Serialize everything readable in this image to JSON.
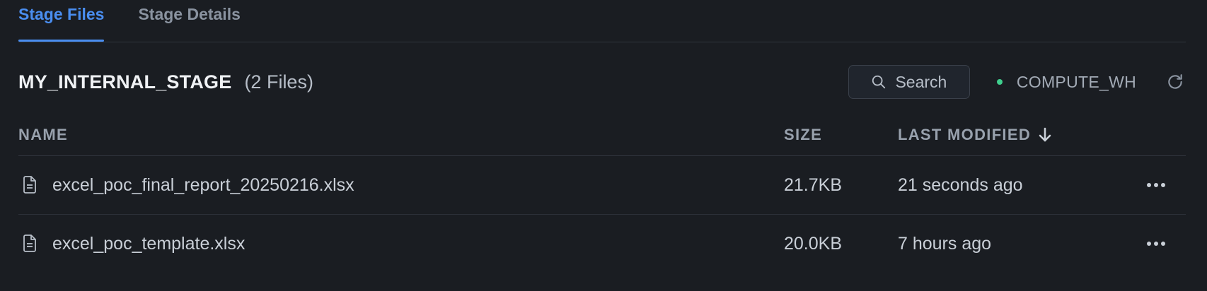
{
  "tabs": [
    {
      "label": "Stage Files",
      "active": true
    },
    {
      "label": "Stage Details",
      "active": false
    }
  ],
  "header": {
    "stage_name": "MY_INTERNAL_STAGE",
    "file_count": "(2 Files)",
    "search_label": "Search",
    "warehouse": "COMPUTE_WH",
    "warehouse_status_color": "#3fcf8e"
  },
  "table": {
    "columns": {
      "name": "NAME",
      "size": "SIZE",
      "last_modified": "LAST MODIFIED"
    },
    "sort": {
      "column": "last_modified",
      "direction": "desc"
    },
    "rows": [
      {
        "name": "excel_poc_final_report_20250216.xlsx",
        "size": "21.7KB",
        "modified": "21 seconds ago"
      },
      {
        "name": "excel_poc_template.xlsx",
        "size": "20.0KB",
        "modified": "7 hours ago"
      }
    ]
  },
  "icons": {
    "search": "search-icon",
    "refresh": "refresh-icon",
    "file": "file-icon",
    "sort": "arrow-down-icon",
    "more": "more-horizontal-icon"
  },
  "colors": {
    "background": "#1a1d22",
    "accent": "#4a8ef0",
    "status_running": "#3fcf8e"
  }
}
